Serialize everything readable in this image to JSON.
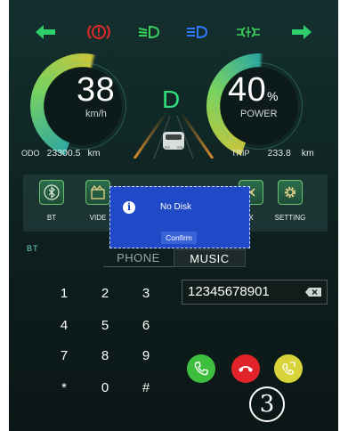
{
  "indicators": [
    {
      "name": "left-turn-arrow-icon",
      "color": "#2fd06a"
    },
    {
      "name": "brake-warning-icon",
      "color": "#e02a2a"
    },
    {
      "name": "low-beam-icon",
      "color": "#38d05a"
    },
    {
      "name": "high-beam-icon",
      "color": "#2f78ff"
    },
    {
      "name": "fog-light-icon",
      "color": "#38d05a"
    },
    {
      "name": "right-turn-arrow-icon",
      "color": "#2fd06a"
    }
  ],
  "speed": {
    "value": "38",
    "unit": "km/h"
  },
  "gear": {
    "value": "D",
    "color": "#31e07a"
  },
  "power": {
    "value": "40",
    "percent_sign": "%",
    "label": "POWER"
  },
  "odo": {
    "label": "ODO",
    "value": "23300.5",
    "unit": "km"
  },
  "trip": {
    "label": "TRIP",
    "value": "233.8",
    "unit": "km"
  },
  "apps": [
    {
      "label": "BT",
      "icon": "bluetooth-icon"
    },
    {
      "label": "VIDE",
      "icon": "video-icon"
    },
    {
      "label": "X",
      "icon": "box-icon"
    },
    {
      "label": "SETTING",
      "icon": "gear-icon"
    }
  ],
  "dialog": {
    "message": "No Disk",
    "confirm_label": "Confirm",
    "icon": "info-icon",
    "bg_color": "#1f49c7"
  },
  "phone_section": {
    "label": "BT",
    "tabs": [
      {
        "label": "PHONE",
        "active": false
      },
      {
        "label": "MUSIC",
        "active": true
      }
    ]
  },
  "keypad": {
    "keys": [
      "1",
      "2",
      "3",
      "4",
      "5",
      "6",
      "7",
      "8",
      "9",
      "*",
      "0",
      "#"
    ]
  },
  "number_input": {
    "value": "12345678901",
    "clear_icon": "backspace-icon"
  },
  "call_buttons": [
    {
      "name": "answer-call-icon",
      "color": "#3fbd3f"
    },
    {
      "name": "hang-up-icon",
      "color": "#e0242a"
    },
    {
      "name": "switch-call-icon",
      "color": "#d9d33a"
    }
  ],
  "annotation_marker": "3"
}
